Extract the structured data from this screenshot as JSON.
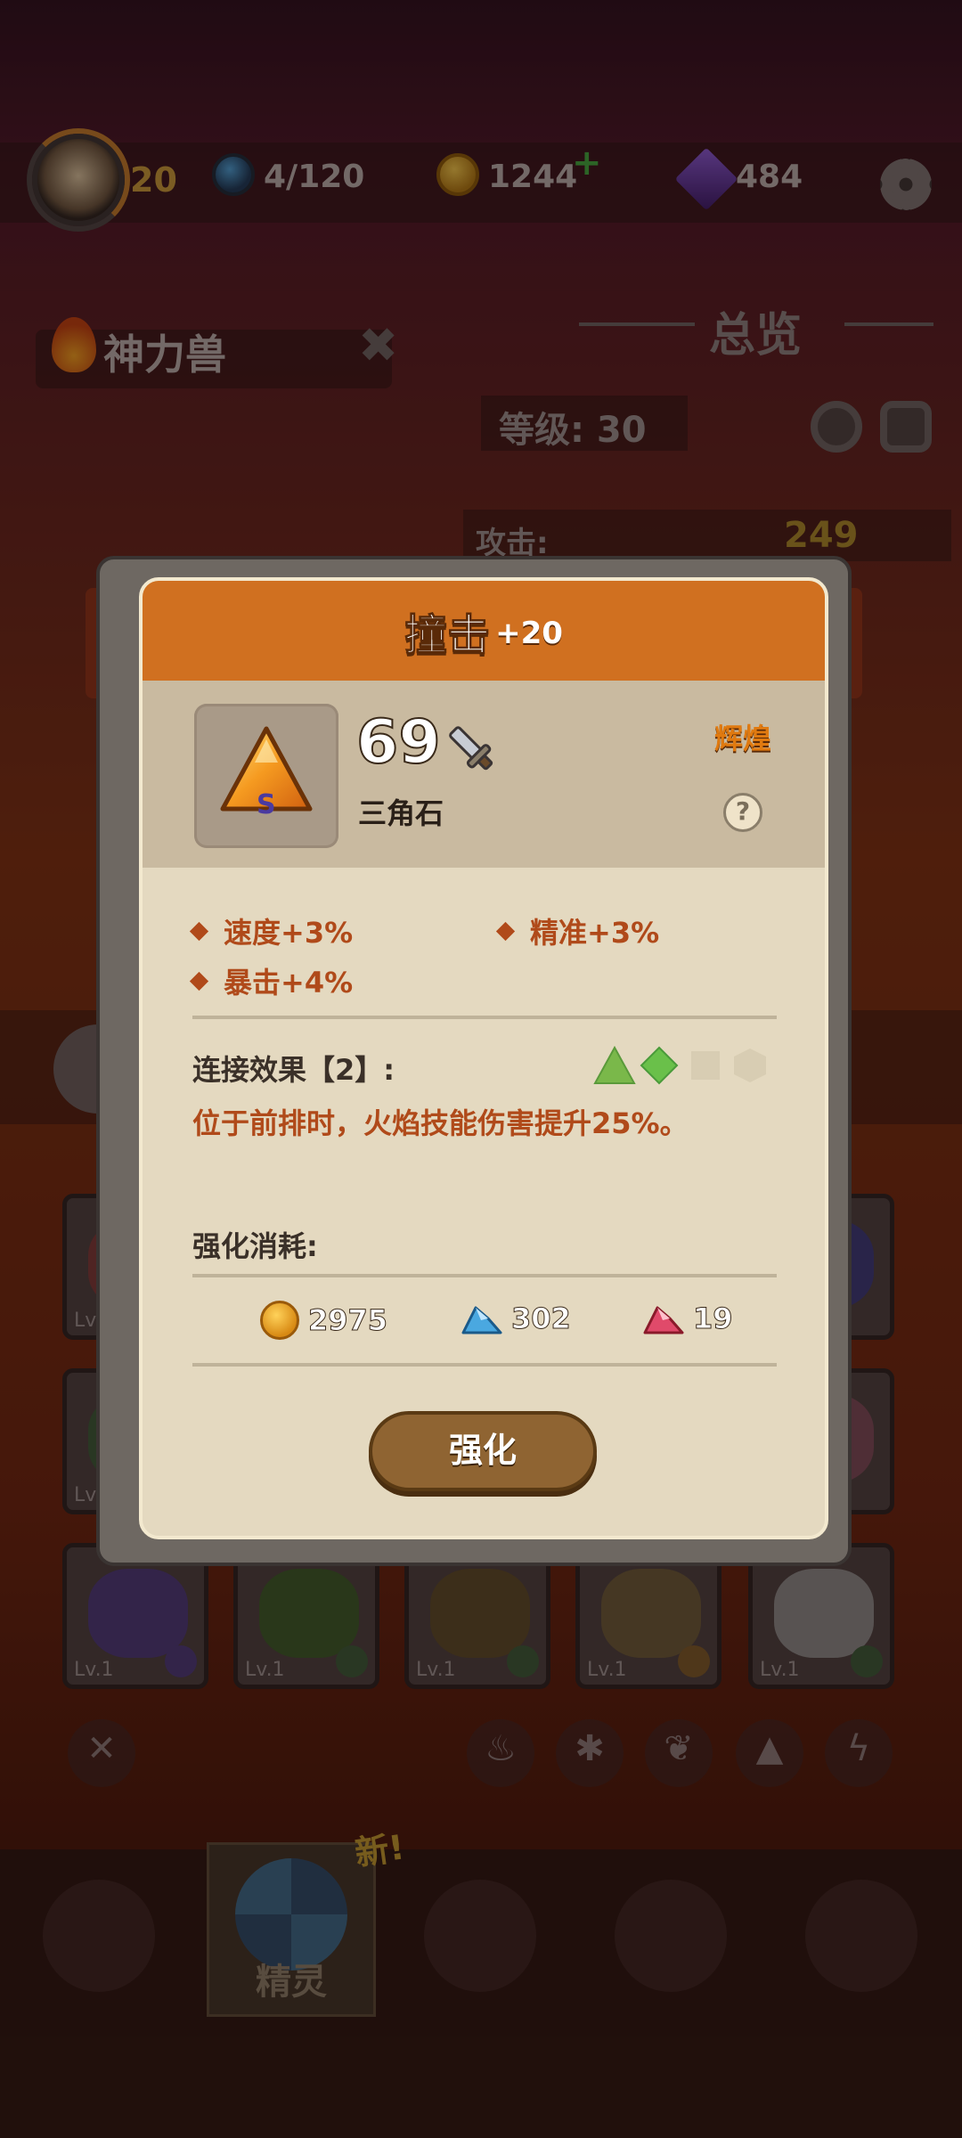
{
  "hud": {
    "player_level": "20",
    "energy": "4/120",
    "coins": "1244",
    "gems": "484",
    "plus_symbol": "+"
  },
  "pet_panel": {
    "pet_name": "神力兽",
    "overview_label": "总览",
    "level_label": "等级: 30",
    "attack_label": "攻击:",
    "attack_value": "249"
  },
  "cards": {
    "level_label": "Lv.1"
  },
  "bottom_nav": {
    "active_label": "精灵",
    "new_badge": "新!"
  },
  "modal": {
    "title": "撞击",
    "title_bonus": "+20",
    "item_power": "69",
    "item_name": "三角石",
    "item_rank": "S",
    "quality": "辉煌",
    "help": "?",
    "stats": [
      "速度+3%",
      "精准+3%",
      "暴击+4%"
    ],
    "link_title": "连接效果【2】:",
    "link_desc": "位于前排时，火焰技能伤害提升25%。",
    "cost_title": "强化消耗:",
    "costs": {
      "coins": "2975",
      "blue_gems": "302",
      "red_gems": "19"
    },
    "enhance_button": "强化"
  },
  "colors": {
    "header_orange": "#d07020",
    "stat_red": "#b04a1a",
    "quality_orange": "#e07a10",
    "panel_beige": "#e4d9c0"
  }
}
